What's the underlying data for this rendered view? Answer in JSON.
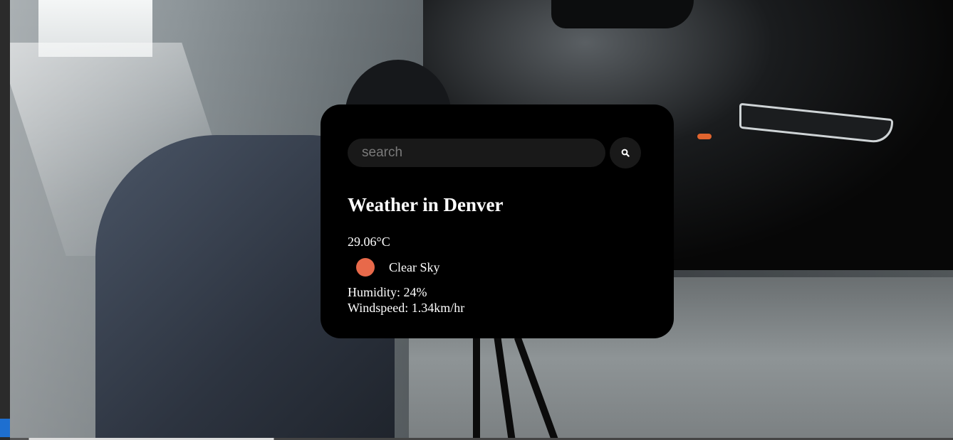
{
  "search": {
    "placeholder": "search",
    "button_icon": "search-icon"
  },
  "weather": {
    "title": "Weather in Denver",
    "temperature": "29.06°C",
    "description": "Clear Sky",
    "description_icon": "sun-icon",
    "humidity": "Humidity: 24%",
    "windspeed": "Windspeed: 1.34km/hr"
  },
  "colors": {
    "card_background": "#000000",
    "input_background": "#191919",
    "sun_icon": "#e8694a",
    "text": "#ffffff"
  }
}
